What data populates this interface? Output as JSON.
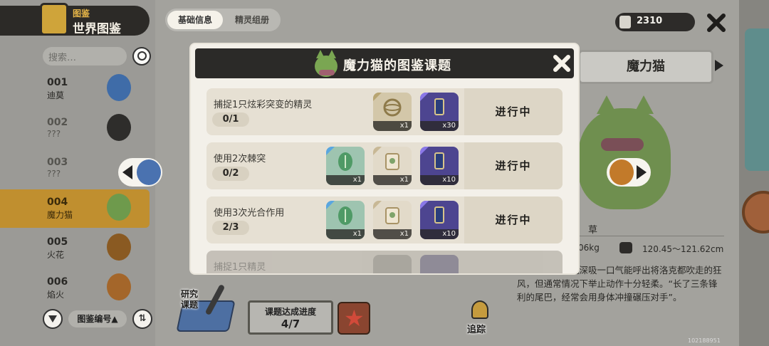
{
  "sidebar": {
    "brand_small": "图鉴",
    "brand_big": "世界图鉴",
    "search_placeholder": "搜索…",
    "entries": [
      {
        "num": "001",
        "name": "迪莫"
      },
      {
        "num": "002",
        "name": "???"
      },
      {
        "num": "003",
        "name": "???"
      },
      {
        "num": "004",
        "name": "魔力猫"
      },
      {
        "num": "005",
        "name": "火花"
      },
      {
        "num": "006",
        "name": "焰火"
      }
    ],
    "sort_label": "图鉴编号▲",
    "sort_order_icon": "⇅"
  },
  "tabs": [
    "基础信息",
    "精灵组册"
  ],
  "coins": "2310",
  "pet": {
    "name": "魔力猫",
    "attribute": "草",
    "weight": "06kg",
    "height": "120.45～121.62cm",
    "description": "体型巨大，据说深吸一口气能呼出将洛克都吹走的狂风，但通常情况下举止动作十分轻柔。“长了三条锋利的尾巴，经常会用身体冲撞碾压对手”。"
  },
  "research": {
    "label_line1": "研究",
    "label_line2": "课题",
    "progress_label": "课题达成进度",
    "progress_value": "4/7",
    "track_label": "追踪"
  },
  "modal": {
    "title": "魔力猫的图鉴课题",
    "tasks": [
      {
        "desc": "捕捉1只炫彩突变的精灵",
        "progress": "0/1",
        "status": "进行中",
        "rewards": [
          {
            "kind": "gold",
            "icon": "orb-icon",
            "qty": "x1"
          },
          {
            "kind": "purple",
            "icon": "charm-icon",
            "qty": "x30"
          }
        ]
      },
      {
        "desc": "使用2次棘突",
        "progress": "0/2",
        "status": "进行中",
        "rewards": [
          {
            "kind": "green",
            "icon": "leaf-gem-icon",
            "qty": "x1"
          },
          {
            "kind": "cream",
            "icon": "scroll-icon",
            "qty": "x1"
          },
          {
            "kind": "purple",
            "icon": "charm-icon",
            "qty": "x10"
          }
        ]
      },
      {
        "desc": "使用3次光合作用",
        "progress": "2/3",
        "status": "进行中",
        "rewards": [
          {
            "kind": "green",
            "icon": "leaf-gem-icon",
            "qty": "x1"
          },
          {
            "kind": "cream",
            "icon": "scroll-icon",
            "qty": "x1"
          },
          {
            "kind": "purple",
            "icon": "charm-icon",
            "qty": "x10"
          }
        ]
      },
      {
        "desc": "捕捉1只精灵",
        "progress": "",
        "status": "",
        "rewards": []
      }
    ]
  },
  "corner_id": "102188951",
  "colors": {
    "header": "#2b2a28",
    "selected": "#c08f2f",
    "modal_bg": "#f3f0e9"
  }
}
